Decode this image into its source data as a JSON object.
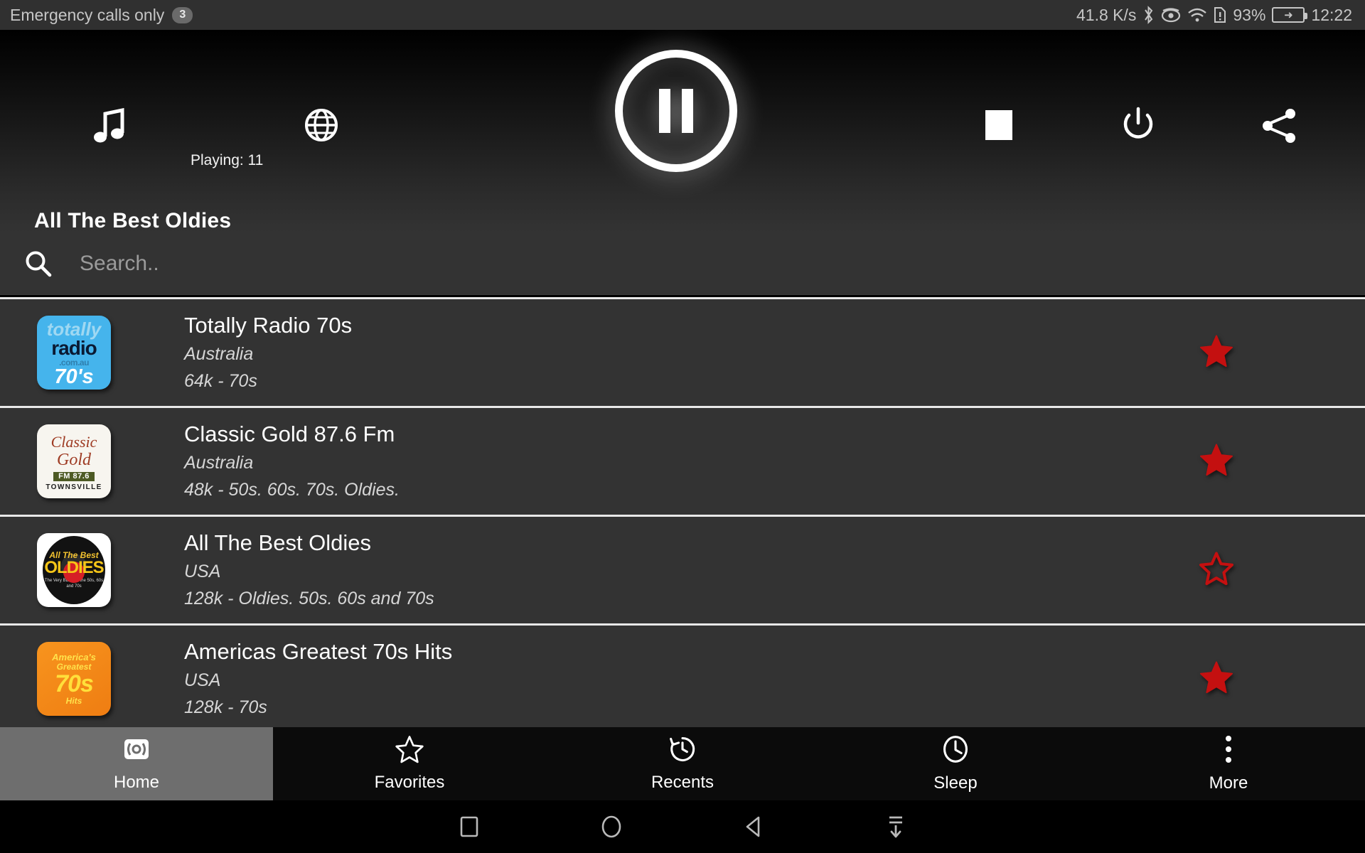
{
  "status_bar": {
    "carrier_text": "Emergency calls only",
    "notification_count": "3",
    "data_rate": "41.8 K/s",
    "icons": [
      "bluetooth-icon",
      "eye-icon",
      "wifi-icon",
      "sim-alert-icon"
    ],
    "battery_percent": "93%",
    "battery_state": "charging",
    "clock": "12:22"
  },
  "player": {
    "music_icon": "music-note-icon",
    "globe_icon": "globe-icon",
    "playing_label": "Playing: 11",
    "transport_state": "pause",
    "stop_icon": "stop-square-icon",
    "power_icon": "power-icon",
    "share_icon": "share-icon",
    "now_playing_title": "All The Best Oldies"
  },
  "search": {
    "icon": "search-icon",
    "value": "",
    "placeholder": "Search.."
  },
  "stations": [
    {
      "name": "Totally Radio 70s",
      "country": "Australia",
      "meta": "64k - 70s",
      "favorite": true,
      "logo": {
        "kind": "totally",
        "l1": "totally",
        "l2": "radio",
        "l3": ".com.au",
        "l4": "70's"
      }
    },
    {
      "name": "Classic Gold 87.6 Fm",
      "country": "Australia",
      "meta": "48k - 50s. 60s. 70s. Oldies.",
      "favorite": true,
      "logo": {
        "kind": "classic",
        "l1": "Classic",
        "l2": "Gold",
        "l3": "FM 87.6",
        "l4": "TOWNSVILLE"
      }
    },
    {
      "name": "All The Best Oldies",
      "country": "USA",
      "meta": "128k - Oldies. 50s. 60s and 70s",
      "favorite": false,
      "logo": {
        "kind": "oldies",
        "l1": "All The Best",
        "l2": "OLDIES",
        "l3": "The Very BEST of the 50s, 60s and 70s"
      }
    },
    {
      "name": "Americas Greatest 70s Hits",
      "country": "USA",
      "meta": "128k - 70s",
      "favorite": true,
      "logo": {
        "kind": "americas",
        "l1": "America's",
        "l2": "Greatest",
        "l3": "70s",
        "l4": "Hits"
      }
    }
  ],
  "bottom_nav": [
    {
      "label": "Home",
      "icon": "radio-broadcast-icon",
      "active": true
    },
    {
      "label": "Favorites",
      "icon": "star-outline-icon",
      "active": false
    },
    {
      "label": "Recents",
      "icon": "history-icon",
      "active": false
    },
    {
      "label": "Sleep",
      "icon": "clock-icon",
      "active": false
    },
    {
      "label": "More",
      "icon": "overflow-dots-icon",
      "active": false
    }
  ],
  "android_nav": [
    "recents-square-icon",
    "home-circle-icon",
    "back-triangle-icon",
    "hide-keyboard-icon"
  ],
  "colors": {
    "favorite_star": "#c41010",
    "panel_bg": "#333333",
    "status_bg": "#303030",
    "active_nav_bg": "#6e6e6e"
  }
}
